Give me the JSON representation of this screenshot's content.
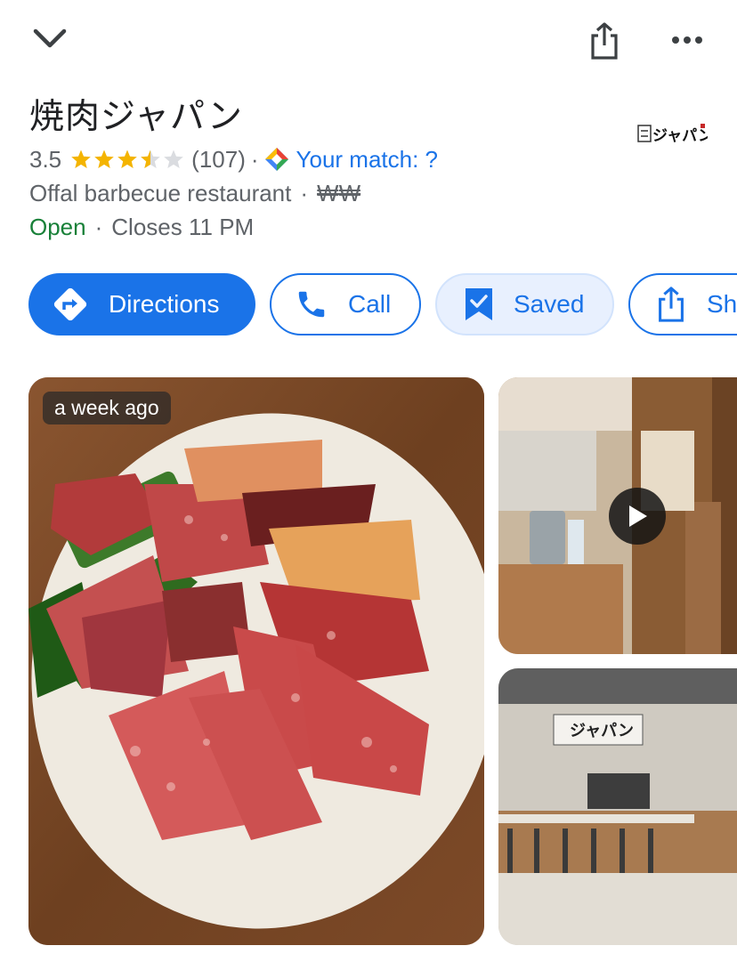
{
  "place": {
    "name": "焼肉ジャパン",
    "rating": "3.5",
    "review_count": "(107)",
    "separator": "·",
    "match_label": "Your match: ?",
    "category": "Offal barbecue restaurant",
    "price_level": "₩₩",
    "status": "Open",
    "hours": "Closes 11 PM",
    "logo_text": "ジャパン"
  },
  "actions": {
    "directions": "Directions",
    "call": "Call",
    "saved": "Saved",
    "share": "Sh"
  },
  "photos": {
    "badge": "a week ago"
  },
  "colors": {
    "accent": "#1a73e8",
    "open": "#188038",
    "star": "#f4b400",
    "star_empty": "#dadce0"
  }
}
